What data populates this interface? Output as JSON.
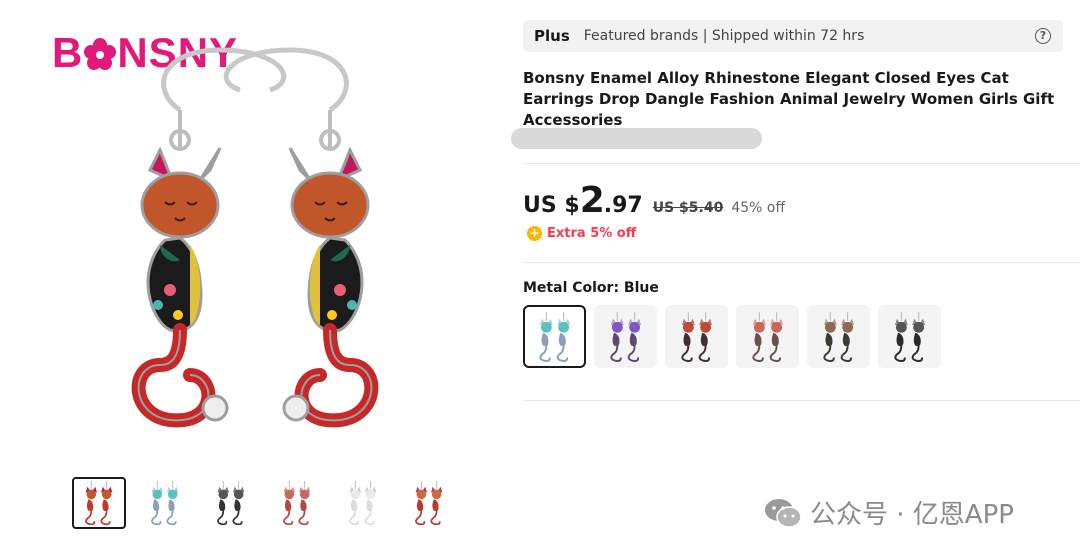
{
  "brand": {
    "logo_text_left": "B",
    "logo_text_right": "NSNY"
  },
  "gallery": {
    "thumbnails": [
      {
        "metal": "logo",
        "body": "#c0392b",
        "head": "#c05a2b",
        "ear": "#c2185b",
        "active": true
      },
      {
        "metal": "blue",
        "body": "#8aa0b8",
        "head": "#5bc0be",
        "ear": "#9fd8d6",
        "active": false
      },
      {
        "metal": "black",
        "body": "#333333",
        "head": "#555555",
        "ear": "#777777",
        "active": false
      },
      {
        "metal": "red",
        "body": "#b64545",
        "head": "#c56a5a",
        "ear": "#d48b8b",
        "active": false
      },
      {
        "metal": "white",
        "body": "#dcdcdc",
        "head": "#eaeaea",
        "ear": "#cfcfcf",
        "active": false
      },
      {
        "metal": "orange",
        "body": "#b73a2b",
        "head": "#d06a3a",
        "ear": "#a5406a",
        "active": false
      }
    ]
  },
  "plus_bar": {
    "label": "Plus",
    "text": "Featured brands | Shipped within 72 hrs",
    "help_icon": "?"
  },
  "product": {
    "title": "Bonsny Enamel Alloy Rhinestone Elegant Closed Eyes Cat Earrings Drop Dangle Fashion Animal Jewelry Women Girls Gift Accessories"
  },
  "price": {
    "prefix": "US $",
    "integer": "2",
    "decimal": ".97",
    "original": "US $5.40",
    "discount": "45% off",
    "extra_icon": "+",
    "extra": "Extra 5% off"
  },
  "variant": {
    "label": "Metal Color: Blue",
    "options": [
      {
        "name": "Blue",
        "head": "#5bc0be",
        "body": "#8aa0b8",
        "ear": "#9fd8d6",
        "active": true
      },
      {
        "name": "Purple",
        "head": "#7e57c2",
        "body": "#5d4a6e",
        "ear": "#b39ddb",
        "active": false
      },
      {
        "name": "Red",
        "head": "#b84a3a",
        "body": "#3c3030",
        "ear": "#d36b6b",
        "active": false
      },
      {
        "name": "Pink",
        "head": "#c9655d",
        "body": "#6a5050",
        "ear": "#e59a9a",
        "active": false
      },
      {
        "name": "Brown",
        "head": "#8a6a55",
        "body": "#3d3a35",
        "ear": "#b59b87",
        "active": false
      },
      {
        "name": "Black",
        "head": "#555555",
        "body": "#2a2a2a",
        "ear": "#888888",
        "active": false
      }
    ]
  },
  "watermark": {
    "text": "公众号 · 亿恩APP"
  },
  "colors": {
    "accent_red": "#fd384f",
    "brand_pink": "#e2197a",
    "coin_yellow": "#ffb400"
  }
}
